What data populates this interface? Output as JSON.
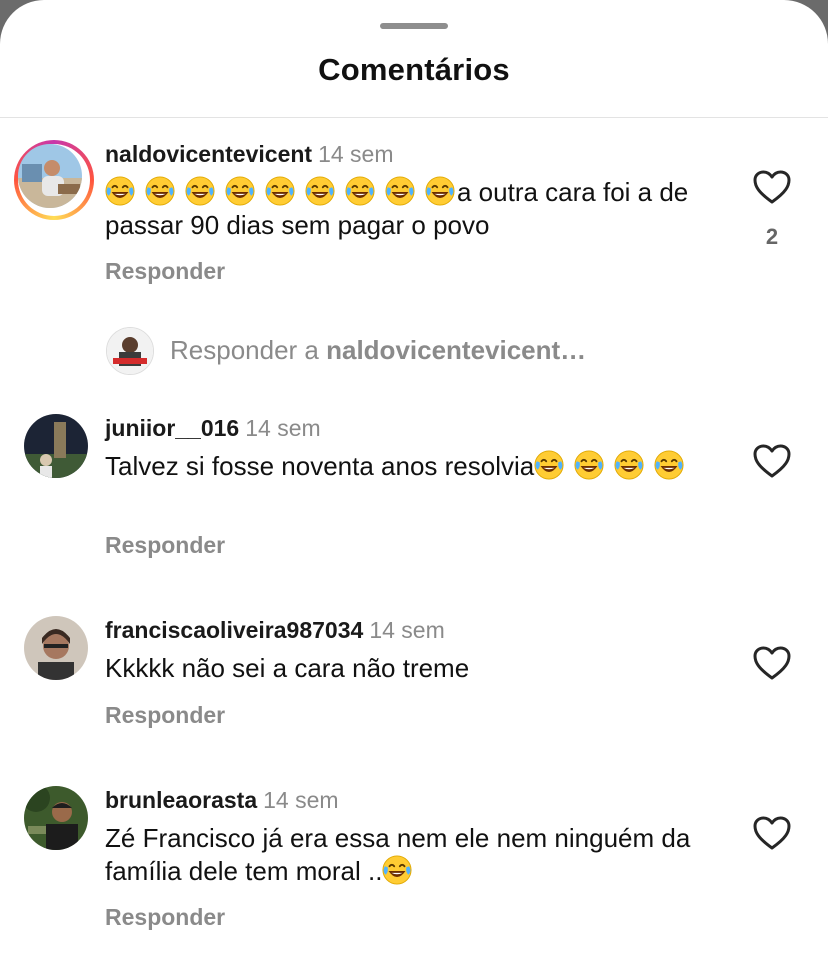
{
  "sheet": {
    "title": "Comentários"
  },
  "comments": [
    {
      "username": "naldovicentevicent",
      "time": "14 sem",
      "text_before_emoji": "",
      "emoji_count": 9,
      "text": "a outra cara  foi a de passar 90 dias sem pagar o povo",
      "reply_label": "Responder",
      "likes": "2",
      "has_story": true
    },
    {
      "username": "juniior__016",
      "time": "14 sem",
      "text": "Talvez si fosse noventa anos resolvia",
      "emoji_count": 4,
      "reply_label": "Responder"
    },
    {
      "username": "franciscaoliveira987034",
      "time": "14 sem",
      "text": "Kkkkk não sei a cara não treme",
      "reply_label": "Responder"
    },
    {
      "username": "brunleaorasta",
      "time": "14 sem",
      "text": "Zé Francisco já era essa nem ele nem ninguém da família dele tem moral ..",
      "emoji_count": 1,
      "reply_label": "Responder"
    }
  ],
  "reply_compose": {
    "prefix": "Responder a ",
    "target": "naldovicentevicent…"
  },
  "icons": {
    "like": "heart-outline-icon",
    "emoji": "face-with-tears-of-joy-emoji"
  },
  "colors": {
    "muted": "#8a8a8a",
    "story_ring": "#c837ab"
  }
}
